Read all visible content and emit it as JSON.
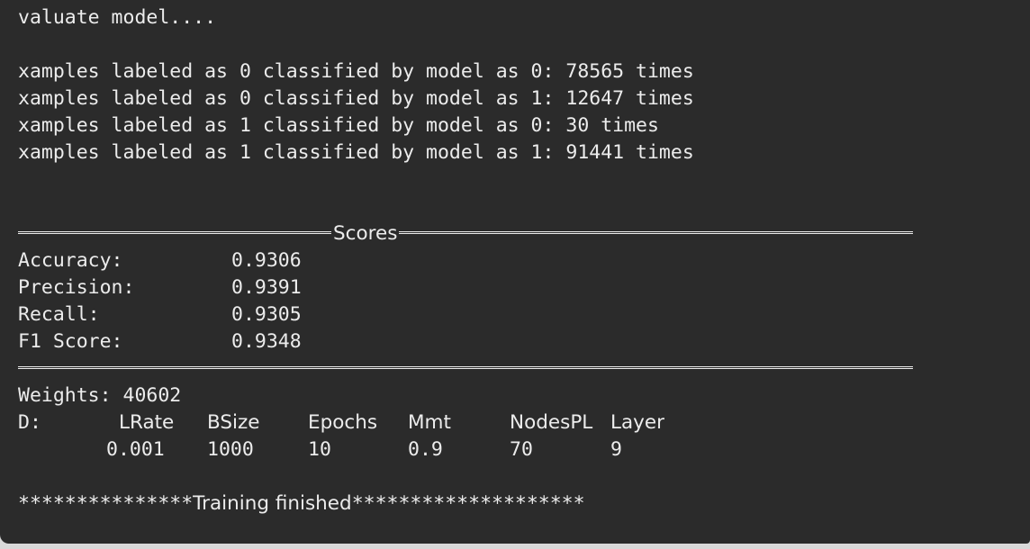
{
  "header": {
    "clipped_line": "valuate model...."
  },
  "confusion": [
    "xamples labeled as 0 classified by model as 0: 78565 times",
    "xamples labeled as 0 classified by model as 1: 12647 times",
    "xamples labeled as 1 classified by model as 0: 30 times",
    "xamples labeled as 1 classified by model as 1: 91441 times"
  ],
  "scores": {
    "title": "Scores",
    "rows": [
      {
        "label": "Accuracy:",
        "value": "0.9306"
      },
      {
        "label": "Precision:",
        "value": "0.9391"
      },
      {
        "label": "Recall:",
        "value": "0.9305"
      },
      {
        "label": "F1 Score:",
        "value": "0.9348"
      }
    ]
  },
  "weights_line": "Weights: 40602",
  "params": {
    "row_label": "D:",
    "headers": [
      "LRate",
      "BSize",
      "Epochs",
      "Mmt",
      "NodesPL",
      "Layer"
    ],
    "values": [
      "0.001",
      "1000",
      "10",
      "0.9",
      "70",
      "9"
    ]
  },
  "footer": {
    "stars_left": "***************",
    "text": "Training finished",
    "stars_right": "********************"
  },
  "colors": {
    "background": "#2b2b2b",
    "text": "#ececec",
    "accent_clipped": "#e63c5a"
  }
}
